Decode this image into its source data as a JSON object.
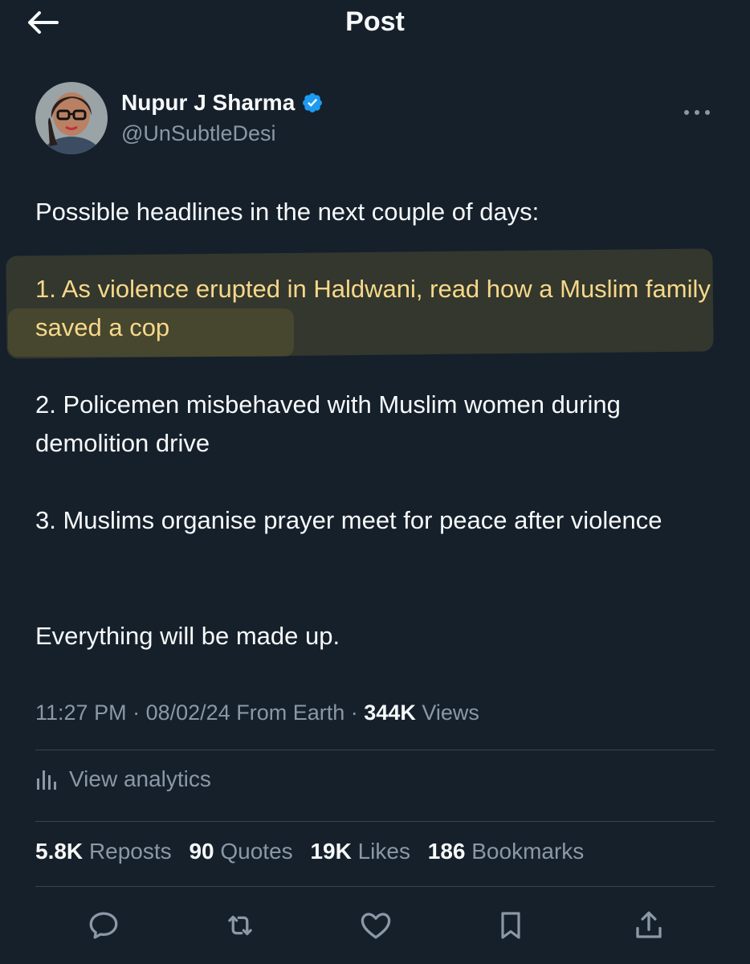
{
  "header": {
    "title": "Post",
    "back_icon": "arrow-left-icon"
  },
  "author": {
    "name": "Nupur J Sharma",
    "handle": "@UnSubtleDesi",
    "verified_icon": "verified-badge-icon",
    "more_icon": "more-horizontal-icon"
  },
  "tweet": {
    "paragraphs": [
      "Possible headlines in the next couple of days:",
      "1. As violence erupted in Haldwani, read how a Muslim family saved a cop",
      "2. Policemen misbehaved with Muslim women during demolition drive",
      "3. Muslims organise prayer meet for peace after violence",
      "Everything will be made up."
    ],
    "highlighted_paragraph_index": 1
  },
  "meta": {
    "time": "11:27 PM",
    "date": "08/02/24",
    "location": "From Earth",
    "views_count": "344K",
    "views_label": "Views"
  },
  "analytics": {
    "label": "View analytics",
    "icon": "analytics-bars-icon"
  },
  "stats": {
    "reposts": {
      "count": "5.8K",
      "label": "Reposts"
    },
    "quotes": {
      "count": "90",
      "label": "Quotes"
    },
    "likes": {
      "count": "19K",
      "label": "Likes"
    },
    "bookmarks": {
      "count": "186",
      "label": "Bookmarks"
    }
  },
  "actions": [
    "reply-icon",
    "repost-icon",
    "like-icon",
    "bookmark-icon",
    "share-icon"
  ],
  "colors": {
    "background": "#15202b",
    "text": "#f7f9f9",
    "secondary_text": "#8b98a5",
    "divider": "#38444d",
    "verified": "#1d9bf0",
    "highlight": "#f7d88a"
  }
}
